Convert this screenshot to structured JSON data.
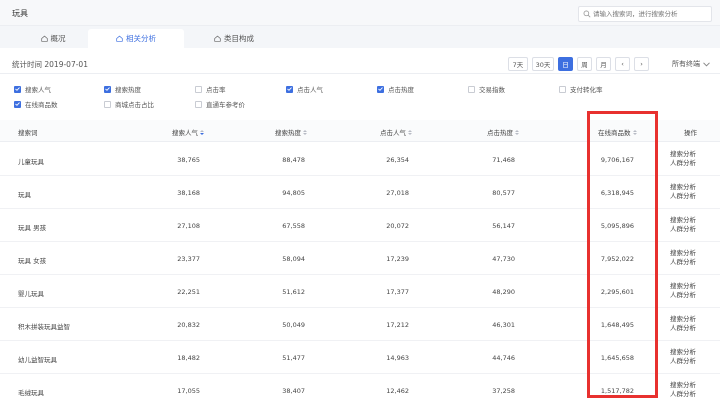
{
  "header": {
    "title": "玩具",
    "search_placeholder": "请输入搜索词，进行搜索分析"
  },
  "tabs": [
    {
      "label": "概况",
      "active": false
    },
    {
      "label": "相关分析",
      "active": true
    },
    {
      "label": "类目构成",
      "active": false
    }
  ],
  "toolbar": {
    "stat_time": "统计时间 2019-07-01",
    "ranges": [
      "7天",
      "30天",
      "日",
      "周",
      "月"
    ],
    "active_range": "日",
    "prev": "‹",
    "next": "›",
    "terminal_label": "所有终端"
  },
  "filters": [
    {
      "label": "搜索人气",
      "checked": true
    },
    {
      "label": "搜索热度",
      "checked": true
    },
    {
      "label": "点击率",
      "checked": false
    },
    {
      "label": "点击人气",
      "checked": true
    },
    {
      "label": "点击热度",
      "checked": true
    },
    {
      "label": "交易指数",
      "checked": false
    },
    {
      "label": "支付转化率",
      "checked": false
    },
    {
      "label": "在线商品数",
      "checked": true
    },
    {
      "label": "商城点击占比",
      "checked": false
    },
    {
      "label": "直通车参考价",
      "checked": false
    }
  ],
  "table": {
    "columns": [
      "搜索词",
      "搜索人气",
      "搜索热度",
      "点击人气",
      "点击热度",
      "在线商品数",
      "操作"
    ],
    "rows": [
      {
        "term": "儿童玩具",
        "search_pop": "38,765",
        "search_heat": "88,478",
        "click_pop": "26,354",
        "click_heat": "71,468",
        "online_items": "9,706,167"
      },
      {
        "term": "玩具",
        "search_pop": "38,168",
        "search_heat": "94,805",
        "click_pop": "27,018",
        "click_heat": "80,577",
        "online_items": "6,318,945"
      },
      {
        "term": "玩具 男孩",
        "search_pop": "27,108",
        "search_heat": "67,558",
        "click_pop": "20,072",
        "click_heat": "56,147",
        "online_items": "5,095,896"
      },
      {
        "term": "玩具 女孩",
        "search_pop": "23,377",
        "search_heat": "58,094",
        "click_pop": "17,239",
        "click_heat": "47,730",
        "online_items": "7,952,022"
      },
      {
        "term": "婴儿玩具",
        "search_pop": "22,251",
        "search_heat": "51,612",
        "click_pop": "17,377",
        "click_heat": "48,290",
        "online_items": "2,295,601"
      },
      {
        "term": "积木拼装玩具益智",
        "search_pop": "20,832",
        "search_heat": "50,049",
        "click_pop": "17,212",
        "click_heat": "46,301",
        "online_items": "1,648,495"
      },
      {
        "term": "幼儿益智玩具",
        "search_pop": "18,482",
        "search_heat": "51,477",
        "click_pop": "14,963",
        "click_heat": "44,746",
        "online_items": "1,645,658"
      },
      {
        "term": "毛绒玩具",
        "search_pop": "17,055",
        "search_heat": "38,407",
        "click_pop": "12,462",
        "click_heat": "37,258",
        "online_items": "1,517,782"
      }
    ],
    "op_labels": [
      "搜索分析",
      "人群分析"
    ]
  },
  "colors": {
    "accent": "#3d6fe0",
    "highlight": "#e8312f"
  }
}
